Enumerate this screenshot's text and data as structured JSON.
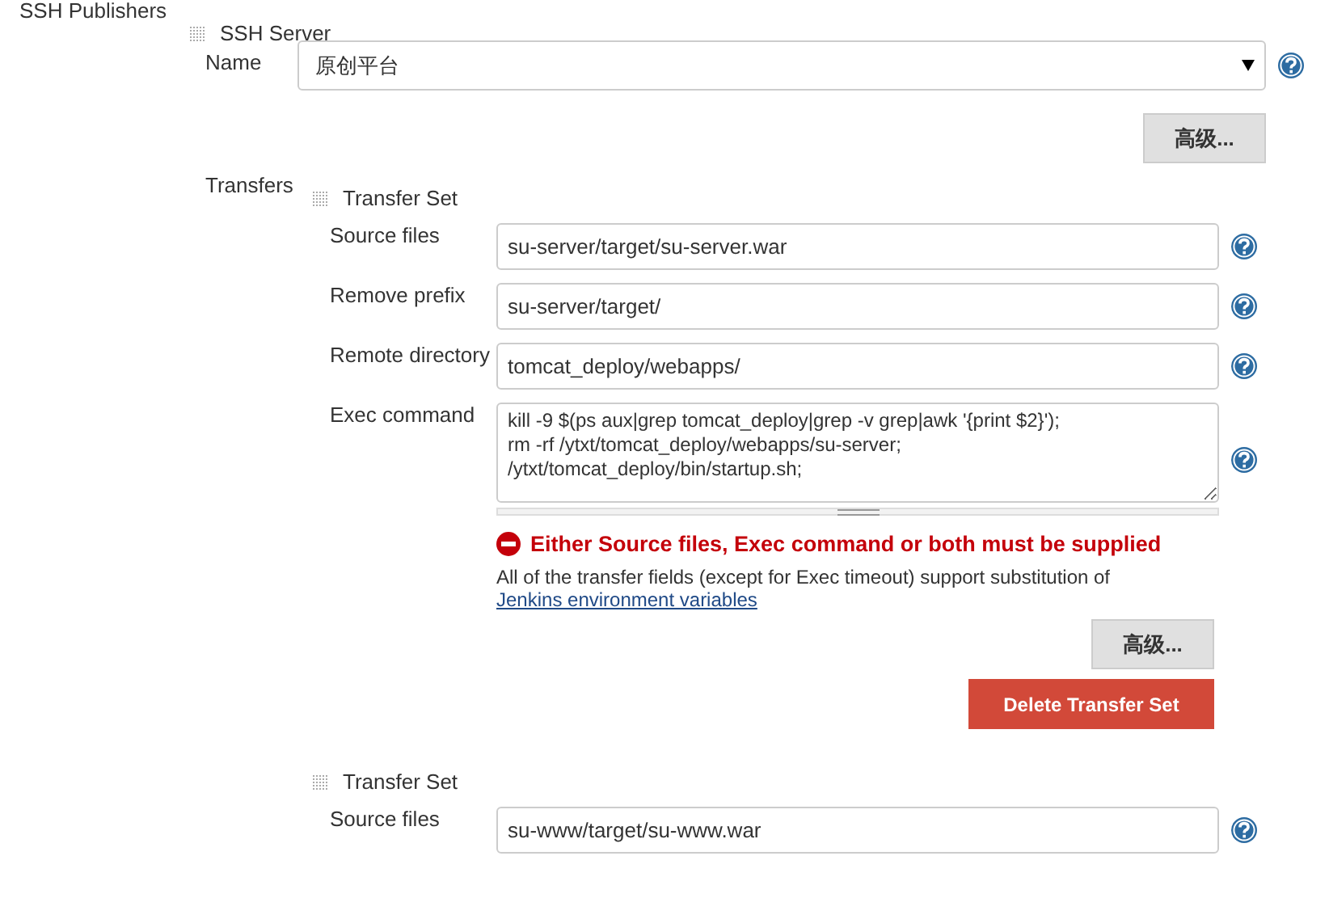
{
  "section_label": "SSH Publishers",
  "ssh_server": {
    "title": "SSH Server",
    "name_label": "Name",
    "name_value": "原创平台",
    "advanced_button": "高级...",
    "transfers_label": "Transfers",
    "transfer_sets": [
      {
        "title": "Transfer Set",
        "fields": [
          {
            "kind": "text",
            "label": "Source files",
            "value": "su-server/target/su-server.war"
          },
          {
            "kind": "text",
            "label": "Remove prefix",
            "value": "su-server/target/"
          },
          {
            "kind": "text",
            "label": "Remote directory",
            "value": "tomcat_deploy/webapps/"
          },
          {
            "kind": "textarea",
            "label": "Exec command",
            "value": "kill -9 $(ps aux|grep tomcat_deploy|grep -v grep|awk '{print $2}');\nrm -rf /ytxt/tomcat_deploy/webapps/su-server;\n/ytxt/tomcat_deploy/bin/startup.sh;"
          }
        ],
        "error": "Either Source files, Exec command or both must be supplied",
        "help_text": "All of the transfer fields (except for Exec timeout) support substitution of ",
        "help_link": "Jenkins environment variables",
        "advanced_button": "高级...",
        "delete_button": "Delete Transfer Set"
      },
      {
        "title": "Transfer Set",
        "fields": [
          {
            "kind": "text",
            "label": "Source files",
            "value": "su-www/target/su-www.war"
          }
        ]
      }
    ]
  }
}
